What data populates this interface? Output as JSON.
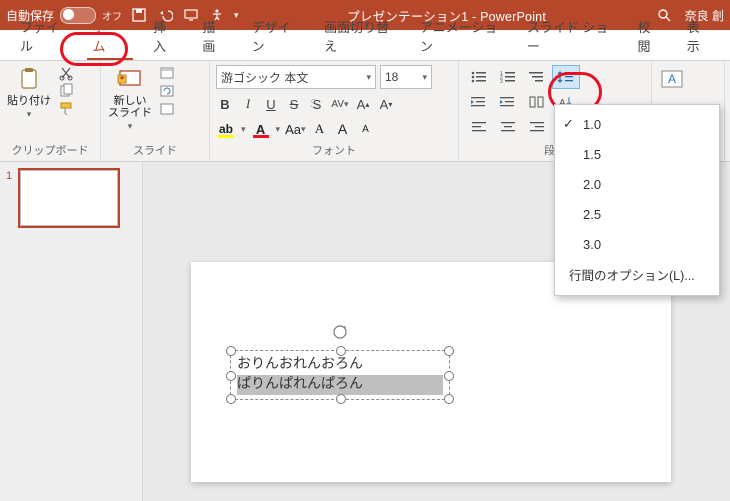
{
  "titlebar": {
    "autosave_label": "自動保存",
    "autosave_state": "オフ",
    "doc_title": "プレゼンテーション1  -  PowerPoint",
    "account": "奈良 創"
  },
  "tabs": {
    "file": "ファイル",
    "home": "ホーム",
    "insert": "挿入",
    "draw": "描画",
    "design": "デザイン",
    "transitions": "画面切り替え",
    "animations": "アニメーション",
    "slideshow": "スライド ショー",
    "review": "校閲",
    "view": "表示"
  },
  "ribbon": {
    "clipboard": {
      "paste": "貼り付け",
      "group": "クリップボード"
    },
    "slides": {
      "new_slide": "新しい\nスライド",
      "group": "スライド"
    },
    "font": {
      "name": "游ゴシック 本文",
      "size": "18",
      "group": "フォント"
    },
    "paragraph": {
      "group": "段落"
    }
  },
  "line_spacing": {
    "v1": "1.0",
    "v2": "1.5",
    "v3": "2.0",
    "v4": "2.5",
    "v5": "3.0",
    "options": "行間のオプション(L)..."
  },
  "thumbs": {
    "n1": "1"
  },
  "textbox": {
    "line1": "おりんおれんおろん",
    "line2": "ぱりんぱれんぱろん"
  }
}
